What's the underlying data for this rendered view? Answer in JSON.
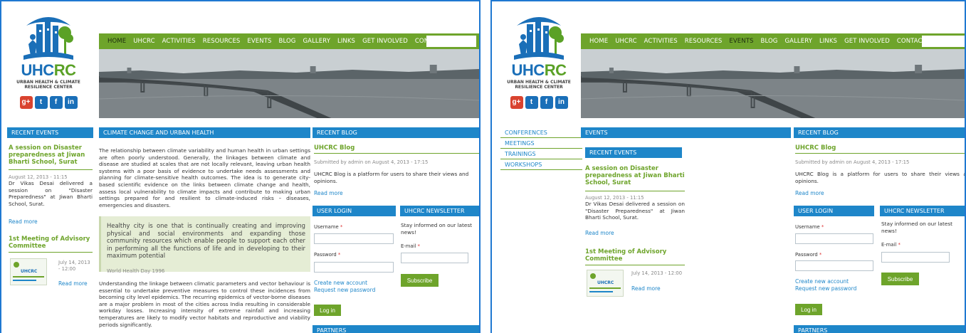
{
  "site": {
    "logo_title_a": "UHC",
    "logo_title_b": "RC",
    "logo_sub_1": "URBAN HEALTH & CLIMATE",
    "logo_sub_2": "RESILIENCE CENTER",
    "socials": [
      "g+",
      "t",
      "f",
      "in"
    ],
    "nav": [
      "HOME",
      "UHCRC",
      "ACTIVITIES",
      "RESOURCES",
      "EVENTS",
      "BLOG",
      "GALLERY",
      "LINKS",
      "GET INVOLVED",
      "CONTACT"
    ],
    "colors": {
      "nav_green": "#6ea42b",
      "bar_blue": "#1e86c9",
      "logo_blue": "#1a6fb8"
    }
  },
  "left": {
    "active_nav": "HOME",
    "recent_events_header": "RECENT EVENTS",
    "event1_title": "A session on Disaster preparedness at Jiwan Bharti School, Surat",
    "event1_date": "August 12, 2013 - 11:15",
    "event1_body": "Dr Vikas Desai delivered a session on \"Disaster Preparedness\" at Jiwan Bharti School, Surat.",
    "read_more": "Read more",
    "event2_title": "1st Meeting of Advisory Committee",
    "event2_date": "July 14, 2013 - 12:00",
    "main_header": "CLIMATE CHANGE AND URBAN HEALTH",
    "main_p1": "The relationship between climate variability and human health in urban settings are often poorly understood. Generally, the linkages between climate and disease are studied at scales that are not locally relevant, leaving urban health systems with a poor basis of evidence to undertake needs assessments and planning for climate-sensitive health outcomes. The idea is to generate city-based scientific evidence on the links between climate change and health, assess local vulnerability to climate impacts and contribute to making urban settings prepared for and resilient to climate-induced risks – diseases, emergencies and disasters.",
    "quote_text": "Healthy city is one that is continually creating and improving physical and social environments and expanding those community resources which enable people to support each other in performing all the functions of life and in developing to their maximum potential",
    "quote_cite": "World Health Day 1996",
    "main_p2": "Understanding the linkage between climatic parameters and vector behaviour is essential to undertake preventive measures to control these incidences from becoming city level epidemics. The recurring epidemics of vector-borne diseases are a major problem in most of the cities across India resulting in considerable workday losses. Increasing intensity of extreme rainfall and increasing temperatures are likely to modify vector habitats and reproductive and viability periods significantly.",
    "blog_header": "RECENT BLOG",
    "blog_title": "UHCRC Blog",
    "blog_meta": "Submitted by admin on August 4, 2013 - 17:15",
    "blog_body": "UHCRC Blog is a platform for users to share their views and opinions.",
    "login_header": "USER LOGIN",
    "username_label": "Username",
    "password_label": "Password",
    "create_account": "Create new account",
    "request_password": "Request new password",
    "login_button": "Log in",
    "newsletter_header": "UHCRC NEWSLETTER",
    "newsletter_text": "Stay informed on our latest news!",
    "email_label": "E-mail",
    "subscribe_button": "Subscribe",
    "partners_header": "PARTNERS",
    "required_mark": "*"
  },
  "right": {
    "active_nav": "EVENTS",
    "side_menu": [
      "CONFERENCES",
      "MEETINGS",
      "TRAININGS",
      "WORKSHOPS"
    ],
    "events_header": "EVENTS",
    "recent_events_header": "RECENT EVENTS",
    "event1_title": "A session on Disaster preparedness at Jiwan Bharti School, Surat",
    "event1_date": "August 12, 2013 - 11:15",
    "event1_body": "Dr Vikas Desai delivered a session on \"Disaster Preparedness\" at Jiwan Bharti School, Surat.",
    "read_more": "Read more",
    "event2_title": "1st Meeting of Advisory Committee",
    "event2_date": "July 14, 2013 - 12:00",
    "blog_header": "RECENT BLOG",
    "blog_title": "UHCRC Blog",
    "blog_meta": "Submitted by admin on August 4, 2013 - 17:15",
    "blog_body": "UHCRC Blog is a platform for users to share their views and opinions.",
    "login_header": "USER LOGIN",
    "username_label": "Username",
    "password_label": "Password",
    "create_account": "Create new account",
    "request_password": "Request new password",
    "login_button": "Log in",
    "newsletter_header": "UHCRC NEWSLETTER",
    "newsletter_text": "Stay informed on our latest news!",
    "email_label": "E-mail",
    "subscribe_button": "Subscribe",
    "partners_header": "PARTNERS",
    "required_mark": "*"
  }
}
